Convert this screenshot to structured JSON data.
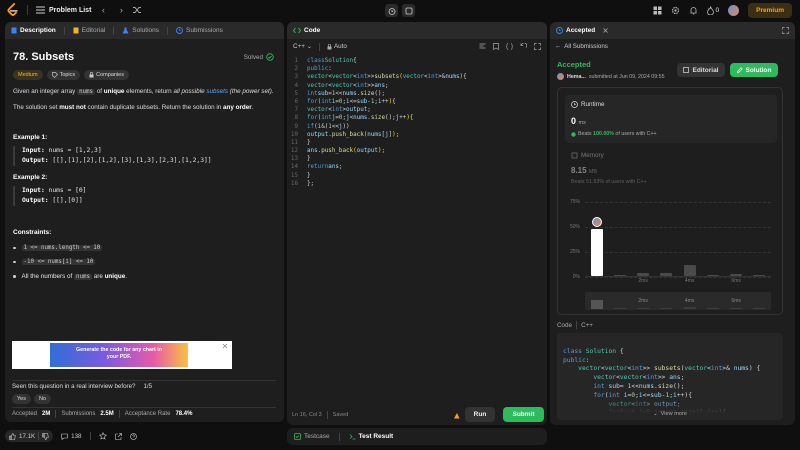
{
  "topbar": {
    "problem_list": "Problem List",
    "streak_count": "0",
    "premium": "Premium"
  },
  "left": {
    "tabs": [
      "Description",
      "Editorial",
      "Solutions",
      "Submissions"
    ],
    "title": "78. Subsets",
    "solved": "Solved",
    "difficulty": "Medium",
    "topics": "Topics",
    "companies": "Companies",
    "desc1_a": "Given an integer array ",
    "desc1_code": "nums",
    "desc1_b": " of ",
    "desc1_bold": "unique",
    "desc1_c": " elements, return ",
    "desc1_it": "all possible",
    "desc1_link": "subsets",
    "desc1_d": " (the power set).",
    "desc2_a": "The solution set ",
    "desc2_bold": "must not",
    "desc2_b": " contain duplicate subsets. Return the solution in ",
    "desc2_bold2": "any order",
    "desc2_c": ".",
    "ex1_title": "Example 1:",
    "ex1_input_label": "Input:",
    "ex1_input": "nums = [1,2,3]",
    "ex1_output_label": "Output:",
    "ex1_output": "[[],[1],[2],[1,2],[3],[1,3],[2,3],[1,2,3]]",
    "ex2_title": "Example 2:",
    "ex2_input_label": "Input:",
    "ex2_input": "nums = [0]",
    "ex2_output_label": "Output:",
    "ex2_output": "[[],[0]]",
    "constraints_title": "Constraints:",
    "constraints": [
      "1 <= nums.length <= 10",
      "-10 <= nums[i] <= 10"
    ],
    "c3_a": "All the numbers of ",
    "c3_code": "nums",
    "c3_b": " are ",
    "c3_bold": "unique",
    "c3_c": ".",
    "ad_text": "Generate the code for any chart in your PDF.",
    "interview_q": "Seen this question in a real interview before?",
    "interview_page": "1/5",
    "yes": "Yes",
    "no": "No",
    "accepted_label": "Accepted",
    "accepted_val": "2M",
    "submissions_label": "Submissions",
    "submissions_val": "2.5M",
    "rate_label": "Acceptance Rate",
    "rate_val": "78.4%",
    "likes": "17.1K",
    "comments": "138"
  },
  "code": {
    "tab": "Code",
    "lang": "C++",
    "auto": "Auto",
    "status": "Ln 16, Col 3",
    "saved": "Saved",
    "run": "Run",
    "submit": "Submit",
    "testcase": "Testcase",
    "test_result": "Test Result",
    "line_numbers": [
      "1",
      "2",
      "3",
      "4",
      "5",
      "6",
      "7",
      "8",
      "9",
      "10",
      "11",
      "12",
      "13",
      "14",
      "15",
      "16"
    ]
  },
  "right": {
    "tab": "Accepted",
    "all_submissions": "All Submissions",
    "status": "Accepted",
    "user": "Hema...",
    "submitted": "submitted at Jun 09, 2024 09:55",
    "editorial": "Editorial",
    "solution": "Solution",
    "runtime_label": "Runtime",
    "runtime_val": "0",
    "runtime_unit": "ms",
    "runtime_beats_a": "Beats ",
    "runtime_beats_pct": "100.00%",
    "runtime_beats_b": " of users with C++",
    "memory_label": "Memory",
    "memory_val": "8.15",
    "memory_unit": "MB",
    "memory_beats": "Beats 51.93% of users with C++",
    "code_label": "Code",
    "code_lang": "C++",
    "view_more": "View more"
  },
  "chart_data": {
    "type": "bar",
    "yticks": [
      "75%",
      "50%",
      "25%",
      "0%"
    ],
    "xticks": [
      "2ms",
      "4ms",
      "6ms"
    ],
    "ylim": [
      0,
      75
    ],
    "values": [
      47,
      1.5,
      3,
      3,
      11,
      1.5,
      2,
      1.5
    ]
  },
  "colors": {
    "accent": "#2cbb5d",
    "orange": "#ffa116",
    "medium": "#ffb800"
  }
}
